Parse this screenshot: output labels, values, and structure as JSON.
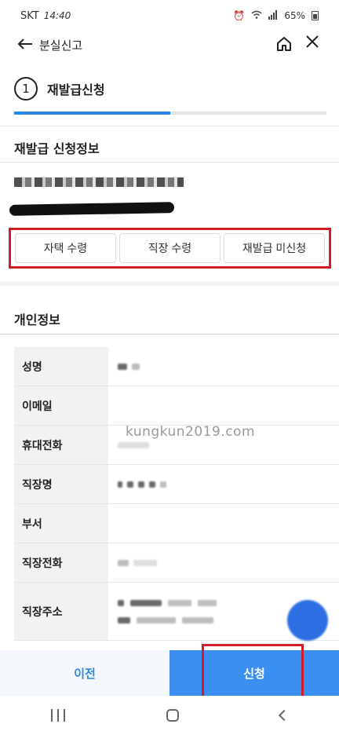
{
  "status_bar": {
    "carrier": "SKT",
    "time": "14:40",
    "battery": "65%"
  },
  "header": {
    "title": "분실신고"
  },
  "step": {
    "number": "1",
    "title": "재발급신청",
    "progress_fraction": 0.5
  },
  "reissue_section": {
    "title": "재발급 신청정보",
    "options": [
      "자택 수령",
      "직장 수령",
      "재발급 미신청"
    ]
  },
  "personal_section": {
    "title": "개인정보",
    "rows": [
      {
        "label": "성명"
      },
      {
        "label": "이메일"
      },
      {
        "label": "휴대전화"
      },
      {
        "label": "직장명"
      },
      {
        "label": "부서"
      },
      {
        "label": "직장전화"
      },
      {
        "label": "직장주소"
      }
    ]
  },
  "watermark": "kungkun2019.com",
  "bottom_buttons": {
    "prev": "이전",
    "submit": "신청"
  },
  "colors": {
    "accent": "#2d86e8",
    "highlight": "#d11c2a"
  }
}
